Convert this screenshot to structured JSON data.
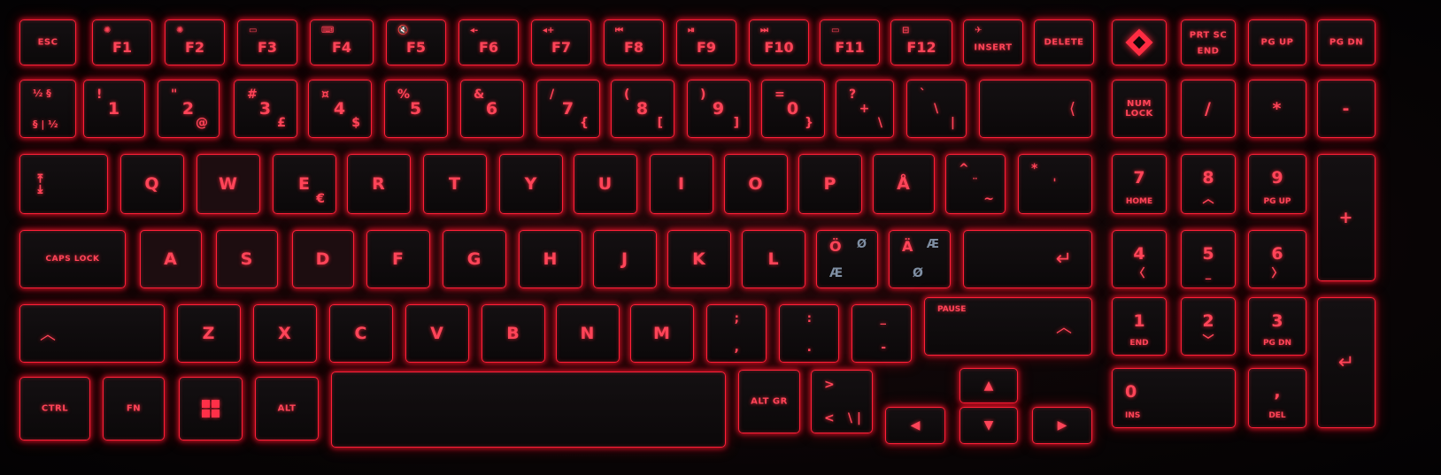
{
  "keys": {
    "esc": "ESC",
    "f1": {
      "num": "F1",
      "icon": "✺"
    },
    "f2": {
      "num": "F2",
      "icon": "✺"
    },
    "f3": {
      "num": "F3",
      "icon": "▭"
    },
    "f4": {
      "num": "F4",
      "icon": "⌨"
    },
    "f5": {
      "num": "F5",
      "icon": "🔇"
    },
    "f6": {
      "num": "F6",
      "icon": "◂-"
    },
    "f7": {
      "num": "F7",
      "icon": "◂+"
    },
    "f8": {
      "num": "F8",
      "icon": "⏮"
    },
    "f9": {
      "num": "F9",
      "icon": "⏯"
    },
    "f10": {
      "num": "F10",
      "icon": "⏭"
    },
    "f11": {
      "num": "F11",
      "icon": "▭"
    },
    "f12": {
      "num": "F12",
      "icon": "⊟"
    },
    "insert": "INSERT",
    "delete": "DELETE",
    "prtsc": "PRT SC",
    "end_top": "END",
    "pgup_top": "PG UP",
    "pgdn_top": "PG DN",
    "num_row": [
      {
        "main": "1",
        "tl": "!"
      },
      {
        "main": "2",
        "tl": "\"",
        "br": "@"
      },
      {
        "main": "3",
        "tl": "#",
        "br": "£"
      },
      {
        "main": "4",
        "tl": "¤",
        "br": "$"
      },
      {
        "main": "5",
        "tl": "%"
      },
      {
        "main": "6",
        "tl": "&"
      },
      {
        "main": "7",
        "tl": "/",
        "br": "{"
      },
      {
        "main": "8",
        "tl": "(",
        "br": "["
      },
      {
        "main": "9",
        "tl": ")",
        "br": "]"
      },
      {
        "main": "0",
        "tl": "=",
        "br": "}"
      },
      {
        "main": "+",
        "tl": "?",
        "br": "\\"
      },
      {
        "main": "\\",
        "tl": "`",
        "br": "|"
      }
    ],
    "section_top": "½ §",
    "section_bottom": "§ | ½",
    "backspace": "⟨",
    "numlock": "NUM LOCK",
    "kp_slash": "/",
    "kp_star": "*",
    "kp_minus": "-",
    "tab": "⇤⇥",
    "q_row": [
      "Q",
      "W",
      "E",
      "R",
      "T",
      "Y",
      "U",
      "I",
      "O",
      "P",
      "Å"
    ],
    "e_alt": "€",
    "caret_key": {
      "tl": "^",
      "ctr": "¨",
      "br": "~"
    },
    "star_key": {
      "tl": "*",
      "ctr": "'"
    },
    "kp7": {
      "main": "7",
      "sub": "HOME"
    },
    "kp8": {
      "main": "8",
      "sub": "︿"
    },
    "kp9": {
      "main": "9",
      "sub": "PG UP"
    },
    "kp_plus": "+",
    "capslock": "CAPS LOCK",
    "a_row": [
      "A",
      "S",
      "D",
      "F",
      "G",
      "H",
      "J",
      "K",
      "L"
    ],
    "oe_key": {
      "tl": "Ö",
      "tr": "Ø",
      "bl": "Æ"
    },
    "ae_key": {
      "tl": "Ä",
      "tr": "Æ",
      "bl": "Ø"
    },
    "enter": "↵",
    "kp4": {
      "main": "4",
      "sub": "〈"
    },
    "kp5": {
      "main": "5",
      "sub": "_"
    },
    "kp6": {
      "main": "6",
      "sub": "〉"
    },
    "lshift": "︿",
    "z_row": [
      "Z",
      "X",
      "C",
      "V",
      "B",
      "N",
      "M"
    ],
    "comma_key": {
      "tl": ";",
      "bl": ","
    },
    "period_key": {
      "tl": ":",
      "bl": "."
    },
    "dash_key": {
      "tl": "_",
      "bl": "-"
    },
    "pause": "PAUSE",
    "rshift": "︿",
    "kp1": {
      "main": "1",
      "sub": "END"
    },
    "kp2": {
      "main": "2",
      "sub": "﹀"
    },
    "kp3": {
      "main": "3",
      "sub": "PG DN"
    },
    "kp_enter": "↵",
    "ctrl": "CTRL",
    "fn": "FN",
    "alt": "ALT",
    "altgr": "ALT GR",
    "angle_key": {
      "tl": ">",
      "bl": "<",
      "br": "\\ |"
    },
    "up": "▲",
    "left": "◀",
    "down": "▼",
    "right": "▶",
    "kp0": {
      "main": "0",
      "sub": "INS"
    },
    "kp_del": {
      "main": ",",
      "sub": "DEL"
    }
  }
}
